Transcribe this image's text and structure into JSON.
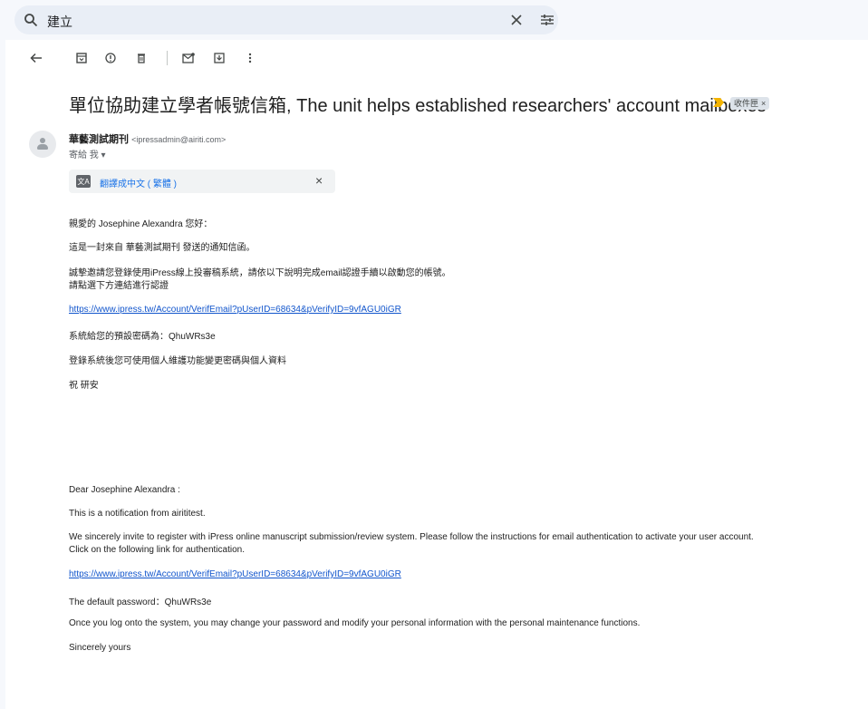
{
  "search": {
    "query": "建立",
    "icons": {
      "search": "search-icon",
      "clear": "close-icon",
      "options": "tune-icon"
    }
  },
  "toolbar": {
    "back": "←",
    "archive": "⊡",
    "report": "ⓘ",
    "delete": "🗑",
    "unread": "✉",
    "move": "⊻",
    "more": "⋮"
  },
  "message": {
    "subject": "單位協助建立學者帳號信箱, The unit helps established researchers' account mailboxes",
    "label": "收件匣",
    "label_close": "×",
    "sender_name": "華藝測試期刊",
    "sender_email": "<ipressadmin@airiti.com>",
    "to": "寄給 我 ▾",
    "translate_label": "翻譯成中文 ( 繁體 )",
    "translate_close": "×",
    "body_zh": [
      "親愛的 Josephine Alexandra 您好：",
      "這是一封來自 華藝測試期刊 發送的通知信函。",
      "誠摯邀請您登錄使用iPress線上投審稿系統，請依以下說明完成email認證手續以啟動您的帳號。",
      "請點選下方連結進行認證",
      "https://www.ipress.tw/Account/VerifEmail?pUserID=68634&pVerifyID=9vfAGU0iGR",
      "系統給您的預設密碼為：QhuWRs3e",
      "登錄系統後您可使用個人維護功能變更密碼與個人資料",
      "祝 研安"
    ],
    "body_en": [
      "Dear Josephine Alexandra :",
      "This is a notification from airititest.",
      "We sincerely invite to register with iPress online manuscript submission/review system. Please follow the instructions for email authentication to activate your user account.",
      "Click on the following link for authentication.",
      "https://www.ipress.tw/Account/VerifEmail?pUserID=68634&pVerifyID=9vfAGU0iGR",
      "The default password：QhuWRs3e",
      "Once you log onto the system, you may change your password and modify your personal information with the personal maintenance functions.",
      "Sincerely yours"
    ]
  },
  "colors": {
    "accent": "#1a73e8",
    "link": "#1155cc",
    "important": "#f4b400",
    "searchbar": "#e9eef6"
  }
}
